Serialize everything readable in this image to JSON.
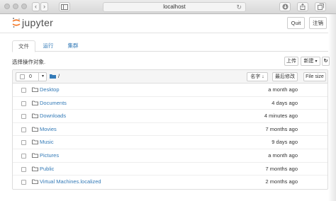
{
  "browser": {
    "url": "localhost",
    "back_glyph": "‹",
    "forward_glyph": "›",
    "reload_glyph": "↻"
  },
  "header": {
    "logo_text": "jupyter",
    "quit_label": "Quit",
    "logout_label": "注销"
  },
  "tabs": [
    {
      "label": "文件",
      "active": true
    },
    {
      "label": "运行",
      "active": false
    },
    {
      "label": "集群",
      "active": false
    }
  ],
  "toolbar": {
    "instruction": "选择操作对象.",
    "upload_label": "上传",
    "new_label": "新建",
    "refresh_glyph": "↻"
  },
  "list_header": {
    "selected_count": "0",
    "dropdown_glyph": "▾",
    "path": "/",
    "sort_name_label": "名字",
    "sort_name_arrow": "↓",
    "sort_modified_label": "最后修改",
    "sort_size_label": "File size"
  },
  "files": [
    {
      "name": "Desktop",
      "modified": "a month ago"
    },
    {
      "name": "Documents",
      "modified": "4 days ago"
    },
    {
      "name": "Downloads",
      "modified": "4 minutes ago"
    },
    {
      "name": "Movies",
      "modified": "7 months ago"
    },
    {
      "name": "Music",
      "modified": "9 days ago"
    },
    {
      "name": "Pictures",
      "modified": "a month ago"
    },
    {
      "name": "Public",
      "modified": "7 months ago"
    },
    {
      "name": "Virtual Machines.localized",
      "modified": "2 months ago"
    }
  ],
  "colors": {
    "link": "#337ab7",
    "folder_icon": "#555555",
    "jupyter_orange": "#f37726"
  }
}
